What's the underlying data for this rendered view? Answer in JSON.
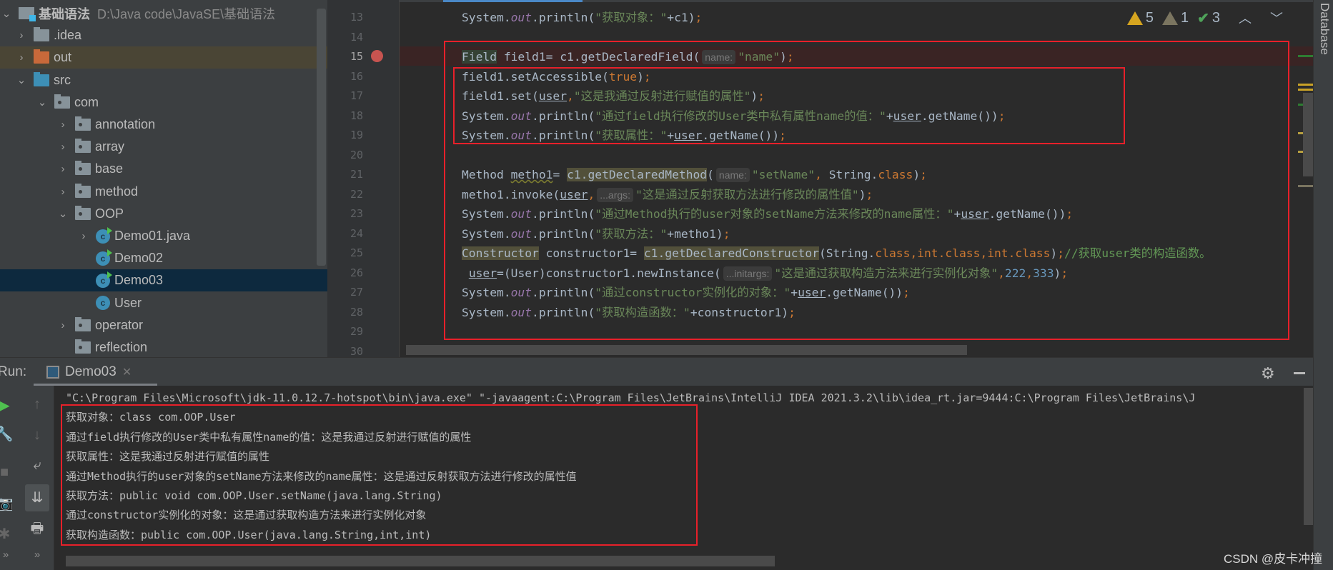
{
  "project_tree": {
    "items": [
      {
        "label": "基础语法",
        "path": "D:\\Java code\\JavaSE\\基础语法",
        "depth": 0,
        "arrow": "down",
        "icon": "project"
      },
      {
        "label": ".idea",
        "depth": 1,
        "arrow": "right",
        "icon": "folder"
      },
      {
        "label": "out",
        "depth": 1,
        "arrow": "right",
        "icon": "folder-orange",
        "state": "highlighted"
      },
      {
        "label": "src",
        "depth": 1,
        "arrow": "down",
        "icon": "folder-blue"
      },
      {
        "label": "com",
        "depth": 2,
        "arrow": "down",
        "icon": "package"
      },
      {
        "label": "annotation",
        "depth": 3,
        "arrow": "right",
        "icon": "package"
      },
      {
        "label": "array",
        "depth": 3,
        "arrow": "right",
        "icon": "package"
      },
      {
        "label": "base",
        "depth": 3,
        "arrow": "right",
        "icon": "package"
      },
      {
        "label": "method",
        "depth": 3,
        "arrow": "right",
        "icon": "package"
      },
      {
        "label": "OOP",
        "depth": 3,
        "arrow": "down",
        "icon": "package"
      },
      {
        "label": "Demo01.java",
        "depth": 4,
        "arrow": "right",
        "icon": "class-runnable"
      },
      {
        "label": "Demo02",
        "depth": 4,
        "arrow": "",
        "icon": "class-runnable"
      },
      {
        "label": "Demo03",
        "depth": 4,
        "arrow": "",
        "icon": "class-runnable",
        "state": "selected"
      },
      {
        "label": "User",
        "depth": 4,
        "arrow": "",
        "icon": "class"
      },
      {
        "label": "operator",
        "depth": 3,
        "arrow": "right",
        "icon": "package"
      },
      {
        "label": "reflection",
        "depth": 3,
        "arrow": "",
        "icon": "package"
      }
    ]
  },
  "editor": {
    "current_line": 15,
    "breakpoint_line": 15,
    "inspections": {
      "warnings": "5",
      "weak_warnings": "1",
      "typos": "3"
    },
    "lines": [
      {
        "n": "13",
        "tokens": [
          [
            "System.",
            "d"
          ],
          [
            "out",
            "o"
          ],
          [
            ".println(",
            "d"
          ],
          [
            "\"获取对象：\"",
            "s"
          ],
          [
            "+c1)",
            "d"
          ],
          [
            ";",
            "k"
          ]
        ]
      },
      {
        "n": "14",
        "tokens": []
      },
      {
        "n": "15",
        "tokens": [
          [
            "Field",
            "f"
          ],
          [
            " field1= c1.getDeclaredField(",
            "d"
          ],
          [
            "name:",
            "h"
          ],
          [
            "\"name\"",
            "s"
          ],
          [
            ")",
            "d"
          ],
          [
            ";",
            "k"
          ]
        ]
      },
      {
        "n": "16",
        "tokens": [
          [
            "field1.setAccessible(",
            "d"
          ],
          [
            "true",
            "k"
          ],
          [
            ")",
            "d"
          ],
          [
            ";",
            "k"
          ]
        ]
      },
      {
        "n": "17",
        "tokens": [
          [
            "field1.set(",
            "d"
          ],
          [
            "user",
            "u"
          ],
          [
            ",",
            "k"
          ],
          [
            "\"这是我通过反射进行赋值的属性\"",
            "s"
          ],
          [
            ")",
            "d"
          ],
          [
            ";",
            "k"
          ]
        ]
      },
      {
        "n": "18",
        "tokens": [
          [
            "System.",
            "d"
          ],
          [
            "out",
            "o"
          ],
          [
            ".println(",
            "d"
          ],
          [
            "\"通过field执行修改的User类中私有属性name的值：\"",
            "s"
          ],
          [
            "+",
            "d"
          ],
          [
            "user",
            "u"
          ],
          [
            ".getName())",
            "d"
          ],
          [
            ";",
            "k"
          ]
        ]
      },
      {
        "n": "19",
        "tokens": [
          [
            "System.",
            "d"
          ],
          [
            "out",
            "o"
          ],
          [
            ".println(",
            "d"
          ],
          [
            "\"获取属性：\"",
            "s"
          ],
          [
            "+",
            "d"
          ],
          [
            "user",
            "u"
          ],
          [
            ".getName())",
            "d"
          ],
          [
            ";",
            "k"
          ]
        ]
      },
      {
        "n": "20",
        "tokens": []
      },
      {
        "n": "21",
        "tokens": [
          [
            "Method ",
            "d"
          ],
          [
            "metho1",
            "w"
          ],
          [
            "= ",
            "d"
          ],
          [
            "c1.getDeclaredMethod",
            "hl"
          ],
          [
            "(",
            "d"
          ],
          [
            "name:",
            "h"
          ],
          [
            "\"setName\"",
            "s"
          ],
          [
            ", ",
            "k"
          ],
          [
            "String.",
            "d"
          ],
          [
            "class",
            "k"
          ],
          [
            ")",
            "d"
          ],
          [
            ";",
            "k"
          ]
        ]
      },
      {
        "n": "22",
        "tokens": [
          [
            "metho1.invoke(",
            "d"
          ],
          [
            "user",
            "u"
          ],
          [
            ",",
            "k"
          ],
          [
            "...args:",
            "h"
          ],
          [
            "\"这是通过反射获取方法进行修改的属性值\"",
            "s"
          ],
          [
            ")",
            "d"
          ],
          [
            ";",
            "k"
          ]
        ]
      },
      {
        "n": "23",
        "tokens": [
          [
            "System.",
            "d"
          ],
          [
            "out",
            "o"
          ],
          [
            ".println(",
            "d"
          ],
          [
            "\"通过Method执行的user对象的setName方法来修改的name属性：\"",
            "s"
          ],
          [
            "+",
            "d"
          ],
          [
            "user",
            "u"
          ],
          [
            ".getName())",
            "d"
          ],
          [
            ";",
            "k"
          ]
        ]
      },
      {
        "n": "24",
        "tokens": [
          [
            "System.",
            "d"
          ],
          [
            "out",
            "o"
          ],
          [
            ".println(",
            "d"
          ],
          [
            "\"获取方法：\"",
            "s"
          ],
          [
            "+metho1)",
            "d"
          ],
          [
            ";",
            "k"
          ]
        ]
      },
      {
        "n": "25",
        "tokens": [
          [
            "Constructor",
            "hl"
          ],
          [
            " constructor1= ",
            "d"
          ],
          [
            "c1.getDeclaredConstructor",
            "hl"
          ],
          [
            "(String.",
            "d"
          ],
          [
            "class,int.class,int.class",
            "k"
          ],
          [
            ")",
            "d"
          ],
          [
            ";",
            "k"
          ],
          [
            "//获取user类的构造函数。",
            "c"
          ]
        ]
      },
      {
        "n": "26",
        "tokens": [
          [
            " ",
            "d"
          ],
          [
            "user",
            "u"
          ],
          [
            "=(User)constructor1.newInstance(",
            "d"
          ],
          [
            "...initargs:",
            "h"
          ],
          [
            "\"这是通过获取构造方法来进行实例化对象\"",
            "s"
          ],
          [
            ",",
            "k"
          ],
          [
            "222",
            "n"
          ],
          [
            ",",
            "k"
          ],
          [
            "333",
            "n"
          ],
          [
            ")",
            "d"
          ],
          [
            ";",
            "k"
          ]
        ]
      },
      {
        "n": "27",
        "tokens": [
          [
            "System.",
            "d"
          ],
          [
            "out",
            "o"
          ],
          [
            ".println(",
            "d"
          ],
          [
            "\"通过constructor实例化的对象：\"",
            "s"
          ],
          [
            "+",
            "d"
          ],
          [
            "user",
            "u"
          ],
          [
            ".getName())",
            "d"
          ],
          [
            ";",
            "k"
          ]
        ]
      },
      {
        "n": "28",
        "tokens": [
          [
            "System.",
            "d"
          ],
          [
            "out",
            "o"
          ],
          [
            ".println(",
            "d"
          ],
          [
            "\"获取构造函数：\"",
            "s"
          ],
          [
            "+constructor1)",
            "d"
          ],
          [
            ";",
            "k"
          ]
        ]
      },
      {
        "n": "29",
        "tokens": []
      },
      {
        "n": "30",
        "tokens": []
      }
    ]
  },
  "right_tool_window": {
    "label": "Database"
  },
  "run_panel": {
    "label": "Run:",
    "tab": "Demo03",
    "icons": [
      "run-icon",
      "wrench-icon",
      "stop-icon",
      "camera-icon",
      "bug-icon",
      "more-icon",
      "up-arrow-icon",
      "down-arrow-icon",
      "soft-wrap-icon",
      "scroll-to-end-icon",
      "print-icon",
      "more-icon"
    ],
    "console_lines": [
      "\"C:\\Program Files\\Microsoft\\jdk-11.0.12.7-hotspot\\bin\\java.exe\" \"-javaagent:C:\\Program Files\\JetBrains\\IntelliJ IDEA 2021.3.2\\lib\\idea_rt.jar=9444:C:\\Program Files\\JetBrains\\J",
      "获取对象：class com.OOP.User",
      "通过field执行修改的User类中私有属性name的值：这是我通过反射进行赋值的属性",
      "获取属性：这是我通过反射进行赋值的属性",
      "通过Method执行的user对象的setName方法来修改的name属性：这是通过反射获取方法进行修改的属性值",
      "获取方法：public void com.OOP.User.setName(java.lang.String)",
      "通过constructor实例化的对象：这是通过获取构造方法来进行实例化对象",
      "获取构造函数：public com.OOP.User(java.lang.String,int,int)"
    ]
  },
  "watermark": "CSDN @皮卡冲撞",
  "colors": {
    "annotation_box": "#e8202a",
    "keyword": "#cc7832",
    "string": "#6a8759",
    "selection": "#0d293e",
    "breakpoint": "#c75450"
  }
}
